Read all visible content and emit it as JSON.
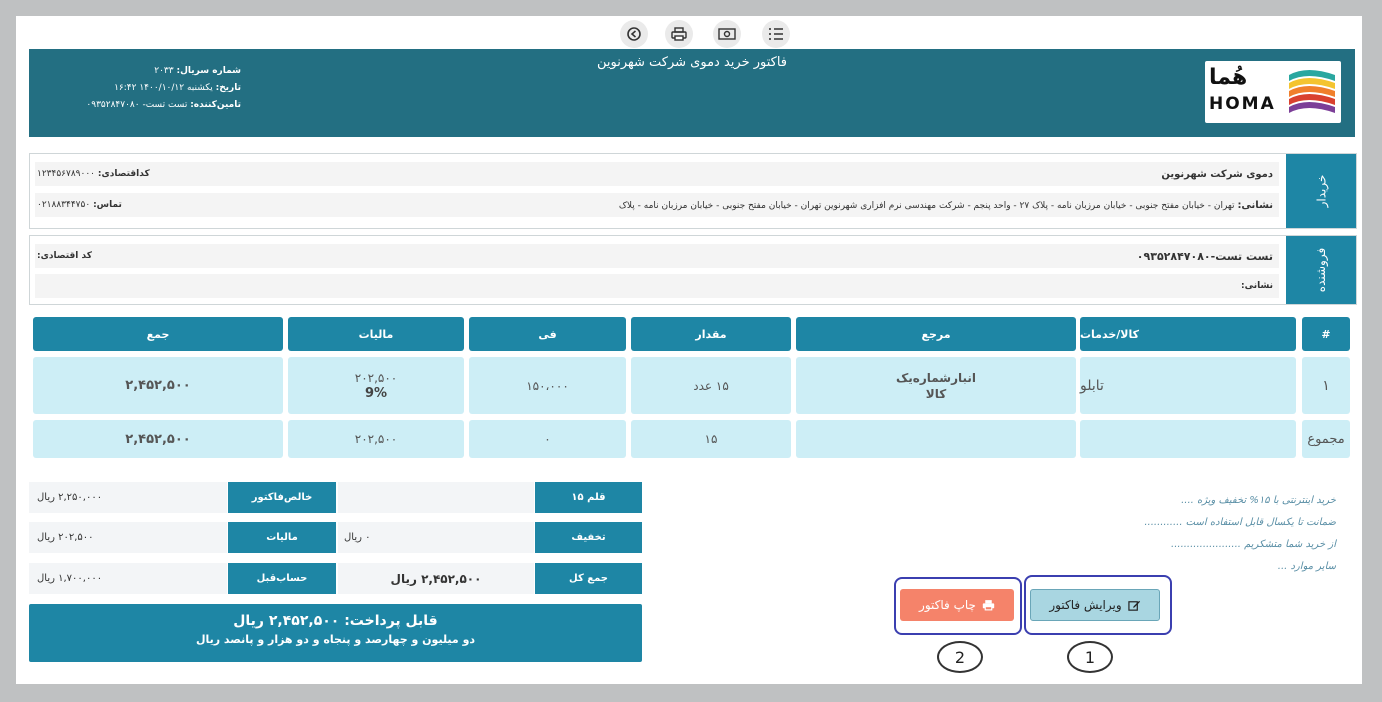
{
  "toolbar": {
    "icons": [
      "back-icon",
      "print-icon",
      "money-icon",
      "list-icon"
    ]
  },
  "header": {
    "title": "فاکتور خرید دموی شرکت شهرنوین",
    "serial_label": "شماره سریال:",
    "serial_value": "۲۰۳۳",
    "date_label": "تاریخ:",
    "date_value": "یکشنبه ۱۴۰۰/۱۰/۱۲ ۱۶:۴۲",
    "supplier_label": "تامین‌کننده:",
    "supplier_value": "تست تست- ۰۹۳۵۲۸۴۷۰۸۰",
    "logo_text": "HOMA",
    "logo_fa": "هُما"
  },
  "buyer": {
    "side_label": "خریدار",
    "name": "دموی شرکت شهرنوین",
    "econ_code_label": "کداقتصادی:",
    "econ_code_value": "۱۲۳۴۵۶۷۸۹۰۰۰",
    "address_label": "نشانی:",
    "address_value": "تهران - خیابان مفتح جنوبی - خیابان مرزبان نامه - پلاک ۲۷ - واحد پنجم - شرکت مهندسی نرم افزاری شهرنوین تهران - خیابان مفتح جنوبی - خیابان مرزبان نامه - پلاک",
    "phone_label": "تماس:",
    "phone_value": "۰۲۱۸۸۳۴۴۷۵۰"
  },
  "seller": {
    "side_label": "فروشنده",
    "name": "تست تست-۰۹۳۵۲۸۴۷۰۸۰",
    "econ_code_label": "کد اقتصادی:",
    "address_label": "نشانی:"
  },
  "table": {
    "headers": {
      "num": "#",
      "item": "کالا/خدمات",
      "ref": "مرجع",
      "qty": "مقدار",
      "price": "فی",
      "tax": "مالیات",
      "total": "جمع"
    },
    "row": {
      "num": "۱",
      "item": "تابلو",
      "ref_line1": "انبارشماره‌یک",
      "ref_line2": "کالا",
      "qty": "۱۵ عدد",
      "price": "۱۵۰،۰۰۰",
      "tax_amount": "۲۰۲,۵۰۰",
      "tax_percent": "9%",
      "total": "۲,۴۵۲,۵۰۰"
    },
    "sum_row": {
      "label": "مجموع",
      "qty": "۱۵",
      "price": "۰",
      "tax": "۲۰۲,۵۰۰",
      "total": "۲,۴۵۲,۵۰۰"
    }
  },
  "totals": {
    "items_count_label": "۱۵ قلم",
    "discount_label": "تخفیف",
    "discount_value": "۰ ریال",
    "grand_label": "جمع کل",
    "grand_value": "۲,۴۵۲,۵۰۰ ریال",
    "net_label": "خالص‌فاکتور",
    "net_value": "۲,۲۵۰,۰۰۰ ریال",
    "tax_label": "مالیات",
    "tax_value": "۲۰۲,۵۰۰ ریال",
    "prev_label": "حساب‌قبل",
    "prev_value": "۱,۷۰۰,۰۰۰ ریال",
    "payable_label": "قابل پرداخت: ۲,۴۵۲,۵۰۰ ریال",
    "payable_words": "دو میلیون و چهارصد و پنجاه و دو هزار و پانصد ریال"
  },
  "notes": [
    "خرید اینترنتی با ۱۵% تخفیف ویژه ....",
    "ضمانت تا یکسال قابل استفاده است ............",
    "از خرید شما متشکریم ......................",
    "سایر موارد ..."
  ],
  "actions": {
    "print_label": "چاپ فاکتور",
    "edit_label": "ویرایش فاکتور",
    "callout_1": "1",
    "callout_2": "2"
  },
  "colors": {
    "header_bg": "#236f82",
    "accent": "#1e86a5",
    "row_bg": "#cdeef6",
    "print_btn": "#f5836a",
    "edit_btn": "#a9d6e1",
    "highlight": "#3b3fb0"
  }
}
